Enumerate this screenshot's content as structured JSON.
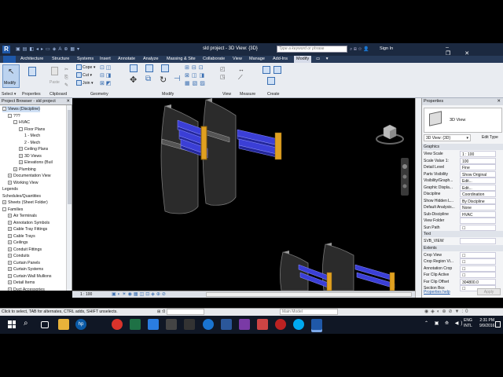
{
  "app": {
    "title": "sld project - 3D View: {3D}",
    "search_placeholder": "Type a keyword or phrase",
    "sign_in": "Sign In"
  },
  "ribbon_tabs": [
    "Architecture",
    "Structure",
    "Systems",
    "Insert",
    "Annotate",
    "Analyze",
    "Massing & Site",
    "Collaborate",
    "View",
    "Manage",
    "Add-Ins",
    "Modify"
  ],
  "ribbon": {
    "modify_label": "Modify",
    "properties_label": "Properties",
    "paste_label": "Paste",
    "cope_label": "Cope",
    "cut_label": "Cut",
    "join_label": "Join",
    "panels": [
      "Select ▾",
      "Properties",
      "Clipboard",
      "Geometry",
      "Modify",
      "View",
      "Measure",
      "Create"
    ]
  },
  "project_browser": {
    "header": "Project Browser - sld project",
    "items": [
      {
        "label": "Views (Discipline)",
        "level": 0,
        "exp": "-"
      },
      {
        "label": "???",
        "level": 1,
        "exp": "-"
      },
      {
        "label": "HVAC",
        "level": 2,
        "exp": "-"
      },
      {
        "label": "Floor Plans",
        "level": 3,
        "exp": "-"
      },
      {
        "label": "1 - Mech",
        "level": 4,
        "exp": ""
      },
      {
        "label": "2 - Mech",
        "level": 4,
        "exp": ""
      },
      {
        "label": "Ceiling Plans",
        "level": 3,
        "exp": "+"
      },
      {
        "label": "3D Views",
        "level": 3,
        "exp": "+"
      },
      {
        "label": "Elevations (Buil",
        "level": 3,
        "exp": "+"
      },
      {
        "label": "Plumbing",
        "level": 2,
        "exp": "+"
      },
      {
        "label": "Documentation View",
        "level": 1,
        "exp": "+"
      },
      {
        "label": "Working View",
        "level": 1,
        "exp": "+"
      },
      {
        "label": "Legends",
        "level": 0,
        "exp": ""
      },
      {
        "label": "Schedules/Quantities",
        "level": 0,
        "exp": ""
      },
      {
        "label": "Sheets (Sheet Folder)",
        "level": 0,
        "exp": "+"
      },
      {
        "label": "Families",
        "level": 0,
        "exp": "-"
      },
      {
        "label": "Air Terminals",
        "level": 1,
        "exp": "+"
      },
      {
        "label": "Annotation Symbols",
        "level": 1,
        "exp": "+"
      },
      {
        "label": "Cable Tray Fittings",
        "level": 1,
        "exp": "+"
      },
      {
        "label": "Cable Trays",
        "level": 1,
        "exp": "+"
      },
      {
        "label": "Ceilings",
        "level": 1,
        "exp": "+"
      },
      {
        "label": "Conduit Fittings",
        "level": 1,
        "exp": "+"
      },
      {
        "label": "Conduits",
        "level": 1,
        "exp": "+"
      },
      {
        "label": "Curtain Panels",
        "level": 1,
        "exp": "+"
      },
      {
        "label": "Curtain Systems",
        "level": 1,
        "exp": "+"
      },
      {
        "label": "Curtain Wall Mullions",
        "level": 1,
        "exp": "+"
      },
      {
        "label": "Detail Items",
        "level": 1,
        "exp": "+"
      },
      {
        "label": "Duct Accessories",
        "level": 1,
        "exp": "+"
      }
    ]
  },
  "view": {
    "scale": "1 : 100"
  },
  "properties": {
    "header": "Properties",
    "type_name": "3D View",
    "selector": "3D View: {3D}",
    "edit_type": "Edit Type",
    "sections": [
      {
        "title": "Graphics",
        "rows": [
          {
            "k": "View Scale",
            "v": "1 : 100"
          },
          {
            "k": "Scale Value 1:",
            "v": "100"
          },
          {
            "k": "Detail Level",
            "v": "Fine"
          },
          {
            "k": "Parts Visibility",
            "v": "Show Original"
          },
          {
            "k": "Visibility/Graph...",
            "v": "Edit..."
          },
          {
            "k": "Graphic Displa...",
            "v": "Edit..."
          },
          {
            "k": "Discipline",
            "v": "Coordination"
          },
          {
            "k": "Show Hidden L...",
            "v": "By Discipline"
          },
          {
            "k": "Default Analysis...",
            "v": "None"
          },
          {
            "k": "Sub-Discipline",
            "v": "HVAC"
          },
          {
            "k": "View Folder",
            "v": ""
          },
          {
            "k": "Sun Path",
            "v": "☐"
          }
        ]
      },
      {
        "title": "Text",
        "rows": [
          {
            "k": "SVB_VIEW",
            "v": ""
          }
        ]
      },
      {
        "title": "Extents",
        "rows": [
          {
            "k": "Crop View",
            "v": "☐"
          },
          {
            "k": "Crop Region Vi...",
            "v": "☐"
          },
          {
            "k": "Annotation Crop",
            "v": "☐"
          },
          {
            "k": "Far Clip Active",
            "v": "☐"
          },
          {
            "k": "Far Clip Offset",
            "v": "304800.0"
          },
          {
            "k": "Section Box",
            "v": "☐"
          }
        ]
      }
    ],
    "help_link": "Properties help",
    "apply": "Apply"
  },
  "status": {
    "hint": "Click to select, TAB for alternates, CTRL adds, SHIFT unselects.",
    "workset": ":0",
    "model": "Main Model"
  },
  "taskbar": {
    "lang": "ENG",
    "region": "INTL",
    "time": "2:31 PM",
    "date": "9/9/2016"
  },
  "colors": {
    "title_bar": "#1b2940",
    "ribbon": "#e9ecf1",
    "taskbar": "#101725",
    "duct": "#3b3fd6"
  }
}
